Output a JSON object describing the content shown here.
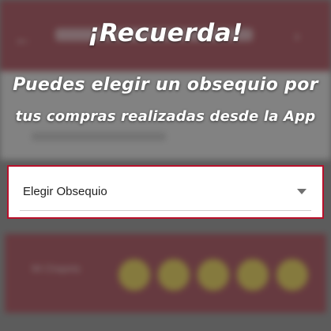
{
  "banner": {
    "headline": "¡Recuerda!",
    "line1": "Puedes elegir un obsequio por",
    "line2": "tus compras realizadas desde la App"
  },
  "gift_select": {
    "value": "Elegir Obsequio",
    "icon": "chevron-down-icon"
  },
  "background_app": {
    "back_icon": "back-arrow-icon",
    "menu_icon": "chevron-right-icon",
    "coupon_label": "Mi Chapeta"
  },
  "colors": {
    "brand_red": "#8b0f1f",
    "highlight_red": "#b8102a",
    "coupon_dot": "#e2c21a"
  }
}
